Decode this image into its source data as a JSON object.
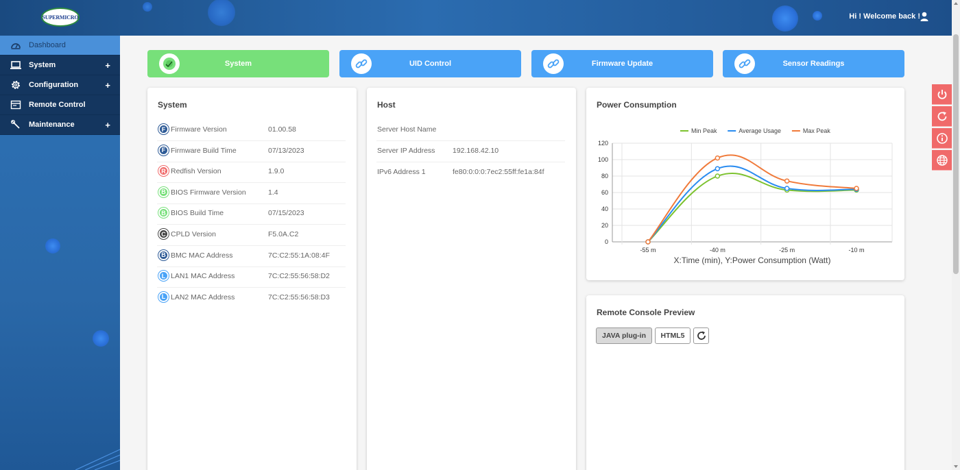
{
  "header": {
    "logo_text": "SUPERMICRO",
    "welcome": "Hi ! Welcome back !"
  },
  "sidebar": {
    "items": [
      {
        "label": "Dashboard",
        "icon": "dashboard-icon",
        "active": true
      },
      {
        "label": "System",
        "icon": "laptop-icon",
        "expandable": true
      },
      {
        "label": "Configuration",
        "icon": "gear-icon",
        "expandable": true
      },
      {
        "label": "Remote Control",
        "icon": "window-icon"
      },
      {
        "label": "Maintenance",
        "icon": "wrench-icon",
        "expandable": true
      }
    ],
    "expand_symbol": "+"
  },
  "tabs": [
    {
      "label": "System",
      "icon": "check-icon",
      "color": "#77e07a"
    },
    {
      "label": "UID Control",
      "icon": "link-icon",
      "color": "#4aa3f7"
    },
    {
      "label": "Firmware Update",
      "icon": "link-icon",
      "color": "#4aa3f7"
    },
    {
      "label": "Sensor Readings",
      "icon": "link-icon",
      "color": "#4aa3f7"
    }
  ],
  "system_card": {
    "title": "System",
    "rows": [
      {
        "badge": "F",
        "badge_color": "#2d5a96",
        "label": "Firmware Version",
        "value": "01.00.58"
      },
      {
        "badge": "F",
        "badge_color": "#2d5a96",
        "label": "Firmware Build Time",
        "value": "07/13/2023"
      },
      {
        "badge": "R",
        "badge_color": "#f06a6a",
        "label": "Redfish Version",
        "value": "1.9.0"
      },
      {
        "badge": "B",
        "badge_color": "#77e07a",
        "label": "BIOS Firmware Version",
        "value": "1.4"
      },
      {
        "badge": "B",
        "badge_color": "#77e07a",
        "label": "BIOS Build Time",
        "value": "07/15/2023"
      },
      {
        "badge": "C",
        "badge_color": "#444444",
        "label": "CPLD Version",
        "value": "F5.0A.C2"
      },
      {
        "badge": "B",
        "badge_color": "#2d5a96",
        "label": "BMC MAC Address",
        "value": "7C:C2:55:1A:08:4F"
      },
      {
        "badge": "L",
        "badge_color": "#4aa3f7",
        "label": "LAN1 MAC Address",
        "value": "7C:C2:55:56:58:D2"
      },
      {
        "badge": "L",
        "badge_color": "#4aa3f7",
        "label": "LAN2 MAC Address",
        "value": "7C:C2:55:56:58:D3"
      }
    ]
  },
  "host_card": {
    "title": "Host",
    "rows": [
      {
        "label": "Server Host Name",
        "value": ""
      },
      {
        "label": "Server IP Address",
        "value": "192.168.42.10"
      },
      {
        "label": "IPv6 Address 1",
        "value": "fe80:0:0:0:7ec2:55ff:fe1a:84f"
      }
    ]
  },
  "power_card": {
    "title": "Power Consumption"
  },
  "chart_data": {
    "type": "line",
    "categories": [
      "-55 m",
      "-40 m",
      "-25 m",
      "-10 m"
    ],
    "series": [
      {
        "name": "Min Peak",
        "color": "#7cc22e",
        "values": [
          0,
          80,
          63,
          63
        ]
      },
      {
        "name": "Average Usage",
        "color": "#2a8cf0",
        "values": [
          0,
          89,
          65,
          64
        ]
      },
      {
        "name": "Max Peak",
        "color": "#f07a3a",
        "values": [
          0,
          102,
          74,
          65
        ]
      }
    ],
    "xlabel": "X:Time (min), Y:Power Consumption (Watt)",
    "ylim": [
      0,
      120
    ],
    "yticks": [
      0,
      20,
      40,
      60,
      80,
      100,
      120
    ],
    "grid": true,
    "legend": "top-center"
  },
  "console_card": {
    "title": "Remote Console Preview",
    "java_label": "JAVA plug-in",
    "html5_label": "HTML5"
  },
  "right_controls": [
    "power-icon",
    "refresh-icon",
    "info-icon",
    "globe-icon"
  ]
}
